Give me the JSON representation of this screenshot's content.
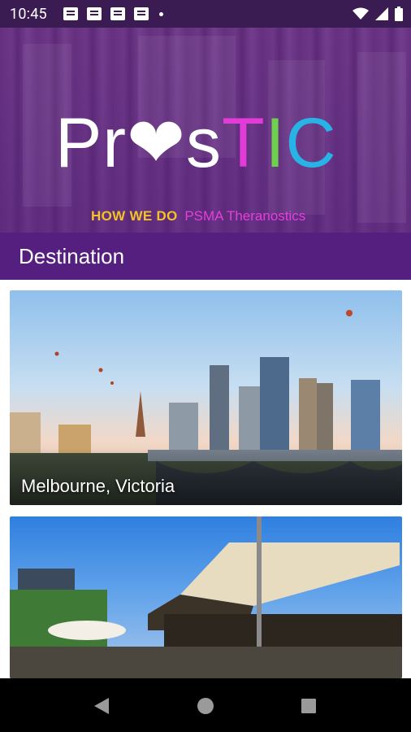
{
  "status_bar": {
    "time": "10:45",
    "notification_icons": [
      "message-icon",
      "message-icon",
      "message-icon",
      "message-icon"
    ],
    "indicators": [
      "wifi-icon",
      "signal-icon",
      "battery-icon"
    ]
  },
  "banner": {
    "logo": {
      "part_pros": "Pr❤s",
      "part_t": "T",
      "part_i": "I",
      "part_c": "C"
    },
    "tagline_how": "HOW WE DO",
    "tagline_psma": "PSMA Theranostics"
  },
  "toolbar": {
    "title": "Destination"
  },
  "cards": [
    {
      "label": "Melbourne, Victoria"
    },
    {
      "label": ""
    }
  ],
  "colors": {
    "status_bar": "#3a1c52",
    "toolbar": "#551f7f",
    "logo_t": "#e23bd8",
    "logo_i": "#6ed14d",
    "logo_c": "#27b3e6",
    "tagline_how": "#f3c323",
    "tagline_psma": "#e63fd9"
  },
  "nav": {
    "buttons": [
      "back-icon",
      "home-icon",
      "recents-icon"
    ]
  }
}
